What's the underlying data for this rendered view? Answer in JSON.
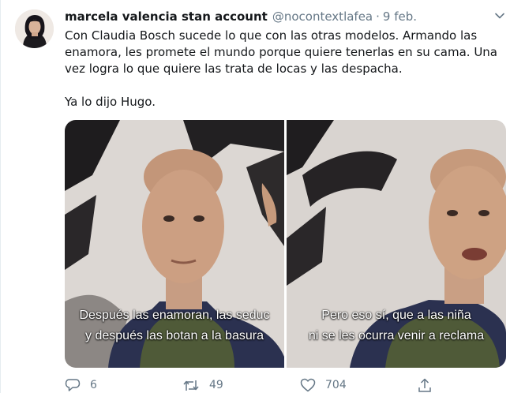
{
  "tweet": {
    "display_name": "marcela valencia stan account",
    "handle": "@nocontextlafea",
    "separator": "·",
    "time": "9 feb.",
    "text": "Con Claudia Bosch sucede lo que con las otras modelos. Armando las enamora, les promete el mundo porque quiere tenerlas en su cama. Una vez logra lo que quiere las trata de locas y las despacha.",
    "text_2": "Ya lo dijo Hugo.",
    "media": {
      "left": {
        "line1": "Después las enamoran, las seduc",
        "line2": "y después las botan a la basura"
      },
      "right": {
        "line1": "Pero eso sí, que a las niña",
        "line2": "ni se les ocurra venir a reclama"
      }
    },
    "actions": {
      "reply_count": "6",
      "retweet_count": "49",
      "like_count": "704"
    }
  },
  "icons": {
    "caret": "chevron-down-icon",
    "reply": "reply-icon",
    "retweet": "retweet-icon",
    "like": "heart-icon",
    "share": "share-icon"
  },
  "colors": {
    "text": "#14171a",
    "secondary": "#657786",
    "divider": "#e6ecf0"
  }
}
